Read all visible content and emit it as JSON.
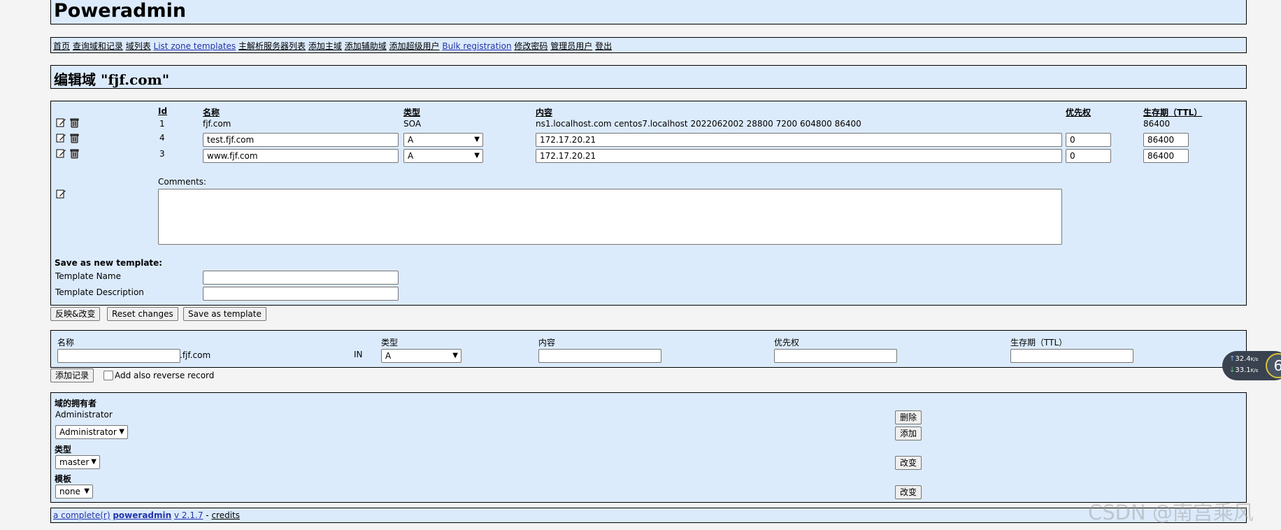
{
  "app_title": "Poweradmin",
  "nav": [
    "首页",
    "查询域和记录",
    "域列表",
    "List zone templates",
    "主解析服务器列表",
    "添加主域",
    "添加辅助域",
    "添加超级用户",
    "Bulk registration",
    "修改密码",
    "管理员用户",
    "登出"
  ],
  "page_title": "编辑域 \"fjf.com\"",
  "records": {
    "headers": {
      "id": "Id",
      "name": "名称",
      "type": "类型",
      "content": "内容",
      "priority": "优先权",
      "ttl": "生存期（TTL）"
    },
    "rows": [
      {
        "id": "1",
        "name": "fjf.com",
        "type": "SOA",
        "content": "ns1.localhost.com centos7.localhost 2022062002 28800 7200 604800 86400",
        "priority": "",
        "ttl": "86400"
      },
      {
        "id": "4",
        "name": "test.fjf.com",
        "type": "A",
        "content": "172.17.20.21",
        "priority": "0",
        "ttl": "86400"
      },
      {
        "id": "3",
        "name": "www.fjf.com",
        "type": "A",
        "content": "172.17.20.21",
        "priority": "0",
        "ttl": "86400"
      }
    ],
    "comments_label": "Comments:",
    "template_heading": "Save as new template:",
    "template_name_label": "Template Name",
    "template_desc_label": "Template Description"
  },
  "buttons": {
    "commit": "反映&改变",
    "reset": "Reset changes",
    "save_template": "Save as template"
  },
  "add_record": {
    "name_label": "名称",
    "suffix": ".fjf.com",
    "class": "IN",
    "type_label": "类型",
    "type_value": "A",
    "content_label": "内容",
    "priority_label": "优先权",
    "ttl_label": "生存期（TTL）",
    "add_button": "添加记录",
    "reverse_label": "Add also reverse record"
  },
  "owner": {
    "heading": "域的拥有者",
    "current": "Administrator",
    "select_value": "Administrator",
    "delete_button": "删除",
    "add_button": "添加",
    "type_heading": "类型",
    "type_value": "master",
    "change_button": "改变",
    "template_heading": "模板",
    "template_value": "none",
    "change_button2": "改变"
  },
  "footer": {
    "part1": "a complete(r)",
    "brand": "poweradmin",
    "version": "v 2.1.7",
    "sep": "-",
    "credits": "credits"
  },
  "speed": {
    "up": "32.4",
    "down": "33.1",
    "unit": "K/s",
    "badge": "6"
  },
  "watermark": "CSDN @南宫乘风"
}
